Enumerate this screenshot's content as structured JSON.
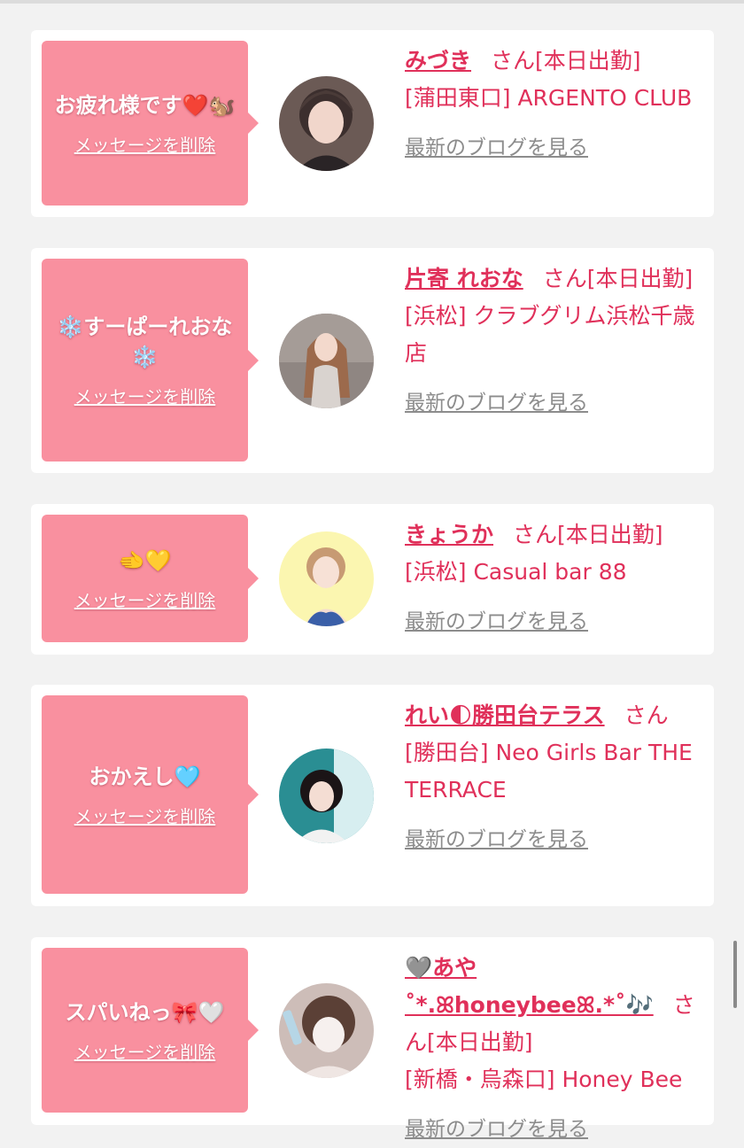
{
  "colors": {
    "accent": "#e0305a",
    "bubble": "#f9909f",
    "link_gray": "#8c8c8c"
  },
  "cards": [
    {
      "message": "お疲れ様です❤️🐿️",
      "delete_label": "メッセージを削除",
      "avatar": "avatar-photo-1",
      "name": "みづき",
      "san": "さん[本日出勤]",
      "store": "[蒲田東口] ARGENTO CLUB",
      "blog_label": "最新のブログを見る"
    },
    {
      "message": "❄️すーぱーれおな❄️",
      "delete_label": "メッセージを削除",
      "avatar": "avatar-photo-2",
      "name": "片寄 れおな",
      "san": "さん[本日出勤]",
      "store": "[浜松] クラブグリム浜松千歳店",
      "blog_label": "最新のブログを見る"
    },
    {
      "message": "🫲💛",
      "delete_label": "メッセージを削除",
      "avatar": "avatar-photo-3",
      "name": "きょうか",
      "san": "さん[本日出勤]",
      "store": "[浜松] Casual bar 88",
      "blog_label": "最新のブログを見る"
    },
    {
      "message": "おかえし🩵",
      "delete_label": "メッセージを削除",
      "avatar": "avatar-photo-4",
      "name": "れい🌓勝田台テラス",
      "san": "さん",
      "store": "[勝田台] Neo Girls Bar THE TERRACE",
      "blog_label": "最新のブログを見る"
    },
    {
      "message": "スパいねっ🎀🤍",
      "delete_label": "メッセージを削除",
      "avatar": "avatar-photo-5",
      "name": "🩶あや˚*.ꕤhoneybeeꕤ.*˚🎶",
      "san": "さん[本日出勤]",
      "store": "[新橋・烏森口] Honey Bee",
      "blog_label": "最新のブログを見る"
    }
  ]
}
